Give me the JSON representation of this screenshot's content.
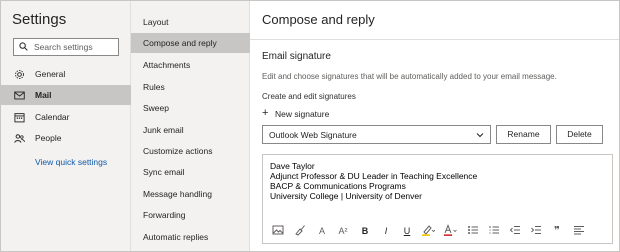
{
  "settings": {
    "title": "Settings",
    "search_placeholder": "Search settings",
    "nav": [
      {
        "label": "General",
        "icon": "gear-icon",
        "active": false
      },
      {
        "label": "Mail",
        "icon": "mail-icon",
        "active": true
      },
      {
        "label": "Calendar",
        "icon": "calendar-icon",
        "active": false
      },
      {
        "label": "People",
        "icon": "people-icon",
        "active": false
      }
    ],
    "quick_settings_link": "View quick settings"
  },
  "mail_menu": {
    "items": [
      {
        "label": "Layout",
        "active": false
      },
      {
        "label": "Compose and reply",
        "active": true
      },
      {
        "label": "Attachments",
        "active": false
      },
      {
        "label": "Rules",
        "active": false
      },
      {
        "label": "Sweep",
        "active": false
      },
      {
        "label": "Junk email",
        "active": false
      },
      {
        "label": "Customize actions",
        "active": false
      },
      {
        "label": "Sync email",
        "active": false
      },
      {
        "label": "Message handling",
        "active": false
      },
      {
        "label": "Forwarding",
        "active": false
      },
      {
        "label": "Automatic replies",
        "active": false
      }
    ]
  },
  "pane": {
    "title": "Compose and reply",
    "section_title": "Email signature",
    "description": "Edit and choose signatures that will be automatically added to your email message.",
    "subheading": "Create and edit signatures",
    "new_signature_label": "New signature",
    "selected_signature": "Outlook Web Signature",
    "rename_label": "Rename",
    "delete_label": "Delete",
    "signature_lines": [
      "Dave Taylor",
      "Adjunct Professor & DU Leader in Teaching Excellence",
      "BACP & Communications Programs",
      "University College | University of Denver"
    ],
    "toolbar_icons": [
      "insert-image-icon",
      "format-painter-icon",
      "font-size-icon",
      "superscript-icon",
      "bold-icon",
      "italic-icon",
      "underline-icon",
      "highlight-icon",
      "font-color-icon",
      "bullets-icon",
      "numbering-icon",
      "decrease-indent-icon",
      "increase-indent-icon",
      "quote-icon",
      "align-icon"
    ],
    "toolbar_glyphs": {
      "font-size-icon": "A",
      "superscript-icon": "A²",
      "bold-icon": "B",
      "italic-icon": "I",
      "underline-icon": "U",
      "quote-icon": "❞"
    }
  },
  "colors": {
    "accent_link": "#0f5aa8",
    "selected_bg": "#c8c6c4",
    "panel_bg": "#f3f2f1",
    "highlight_yellow": "#f2c811",
    "font_color_red": "#d13438"
  }
}
